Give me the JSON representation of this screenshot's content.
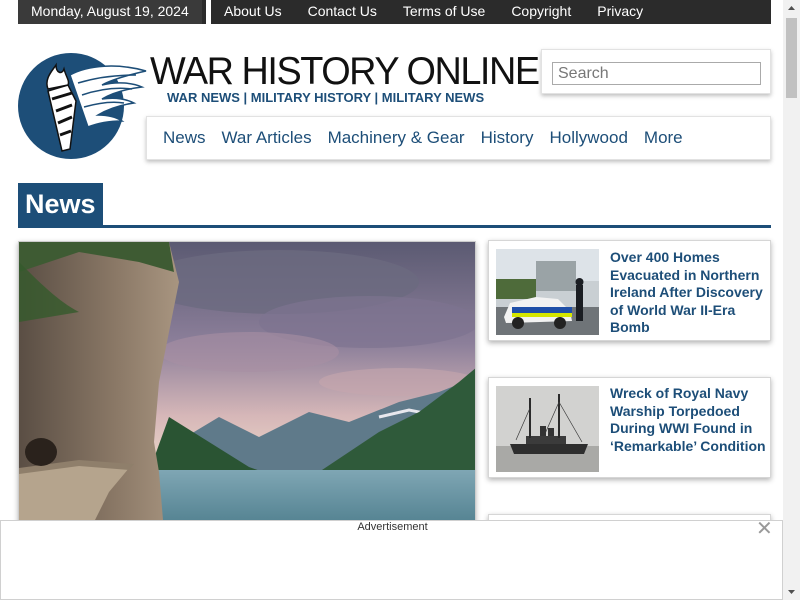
{
  "topbar": {
    "date": "Monday, August 19, 2024",
    "links": [
      "About Us",
      "Contact Us",
      "Terms of Use",
      "Copyright",
      "Privacy"
    ]
  },
  "header": {
    "title": "WAR HISTORY ONLINE",
    "subtitle": "WAR NEWS | MILITARY HISTORY | MILITARY NEWS",
    "logo_icon": "winged-torch-logo"
  },
  "search": {
    "placeholder": "Search",
    "value": ""
  },
  "nav": {
    "items": [
      "News",
      "War Articles",
      "Machinery & Gear",
      "History",
      "Hollywood",
      "More"
    ]
  },
  "section": {
    "title": "News"
  },
  "feature": {
    "image": "mountain-lake-cliff-road-photo"
  },
  "cards": [
    {
      "title": "Over 400 Homes Evacuated in Northern Ireland After Discovery of World War II-Era Bomb",
      "image": "police-car-photo"
    },
    {
      "title": "Wreck of Royal Navy Warship Torpedoed During WWI Found in ‘Remarkable’ Condition",
      "image": "warship-photo"
    }
  ],
  "ad": {
    "label": "Advertisement",
    "close": "✕"
  },
  "colors": {
    "brand": "#1d4e78",
    "topbar": "#2b2b2b"
  }
}
